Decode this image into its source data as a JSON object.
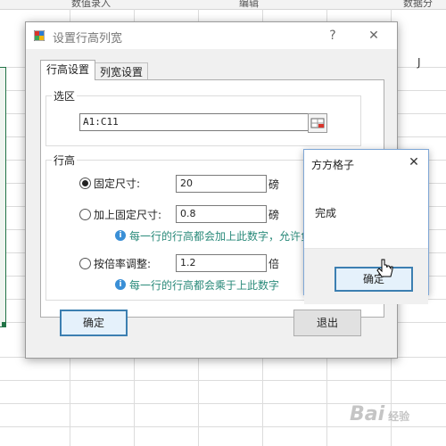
{
  "spreadsheet": {
    "ribbon_items": [
      "数值录入",
      "编辑",
      "数据分"
    ],
    "column_letter": "J",
    "selection_color": "#217346"
  },
  "dialog": {
    "title": "设置行高列宽",
    "help_label": "?",
    "close_label": "✕",
    "tabs": [
      {
        "label": "行高设置",
        "active": true
      },
      {
        "label": "列宽设置",
        "active": false
      }
    ],
    "selection_group": {
      "title": "选区",
      "range_value": "A1:C11"
    },
    "row_height_group": {
      "title": "行高",
      "options": [
        {
          "label": "固定尺寸:",
          "value": "20",
          "unit": "磅",
          "checked": true,
          "hint": ""
        },
        {
          "label": "加上固定尺寸:",
          "value": "0.8",
          "unit": "磅",
          "checked": false,
          "hint": "每一行的行高都会加上此数字，允许负"
        },
        {
          "label": "按倍率调整:",
          "value": "1.2",
          "unit": "倍",
          "checked": false,
          "hint": "每一行的行高都会乘于上此数字"
        }
      ]
    },
    "ok_label": "确定",
    "exit_label": "退出"
  },
  "message_box": {
    "title": "方方格子",
    "close_label": "✕",
    "message": "完成",
    "ok_label": "确定"
  },
  "watermark": {
    "text": "Bai",
    "suffix": "经验"
  }
}
